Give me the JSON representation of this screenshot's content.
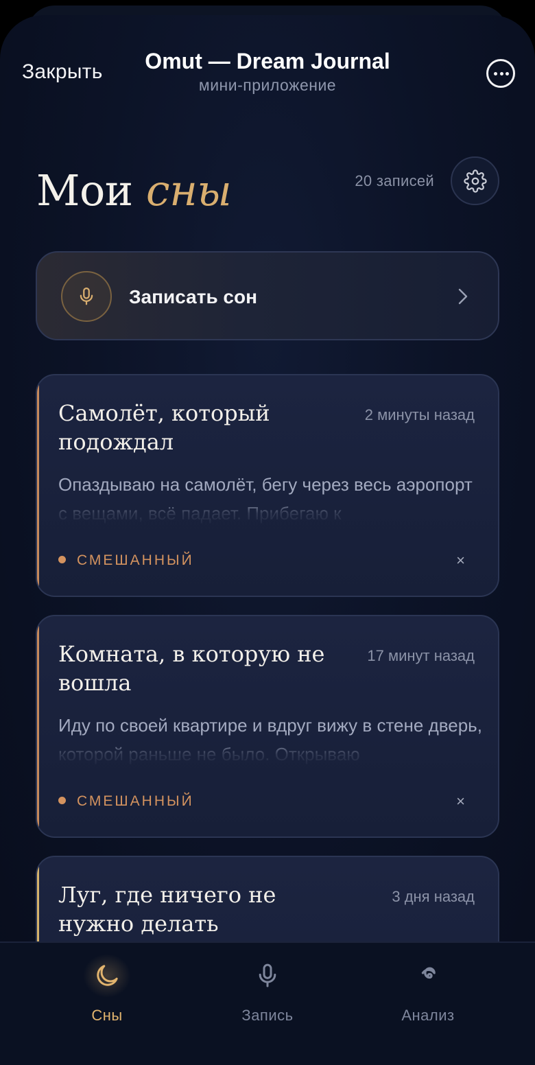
{
  "header": {
    "close_label": "Закрыть",
    "title": "Omut — Dream Journal",
    "subtitle": "мини-приложение",
    "more_icon": "more-horizontal-circle-icon"
  },
  "page": {
    "title_main": "Мои",
    "title_accent": "сны",
    "entries_count": "20 записей",
    "settings_icon": "gear-icon"
  },
  "record": {
    "label": "Записать сон",
    "icon": "microphone-icon",
    "chevron_icon": "chevron-right-icon"
  },
  "dreams": [
    {
      "title": "Самолёт, который подождал",
      "time": "2 минуты назад",
      "text": "Опаздываю на самолёт, бегу через весь аэропорт с вещами, всё падает. Прибегаю к",
      "tag": "СМЕШАННЫЙ",
      "delete": "×"
    },
    {
      "title": "Комната, в которую не вошла",
      "time": "17 минут назад",
      "text": "Иду по своей квартире и вдруг вижу в стене дверь, которой раньше не было. Открываю",
      "tag": "СМЕШАННЫЙ",
      "delete": "×"
    },
    {
      "title": "Луг, где ничего не нужно делать",
      "time": "3 дня назад",
      "text": "",
      "tag": "",
      "delete": ""
    }
  ],
  "nav": [
    {
      "label": "Сны",
      "icon": "moon-icon",
      "active": true
    },
    {
      "label": "Запись",
      "icon": "microphone-icon",
      "active": false
    },
    {
      "label": "Анализ",
      "icon": "spiral-icon",
      "active": false
    }
  ],
  "colors": {
    "background": "#0c1327",
    "accent_gold": "#d9ae6f",
    "tag_copper": "#d4935f",
    "card": "#1c2440"
  }
}
